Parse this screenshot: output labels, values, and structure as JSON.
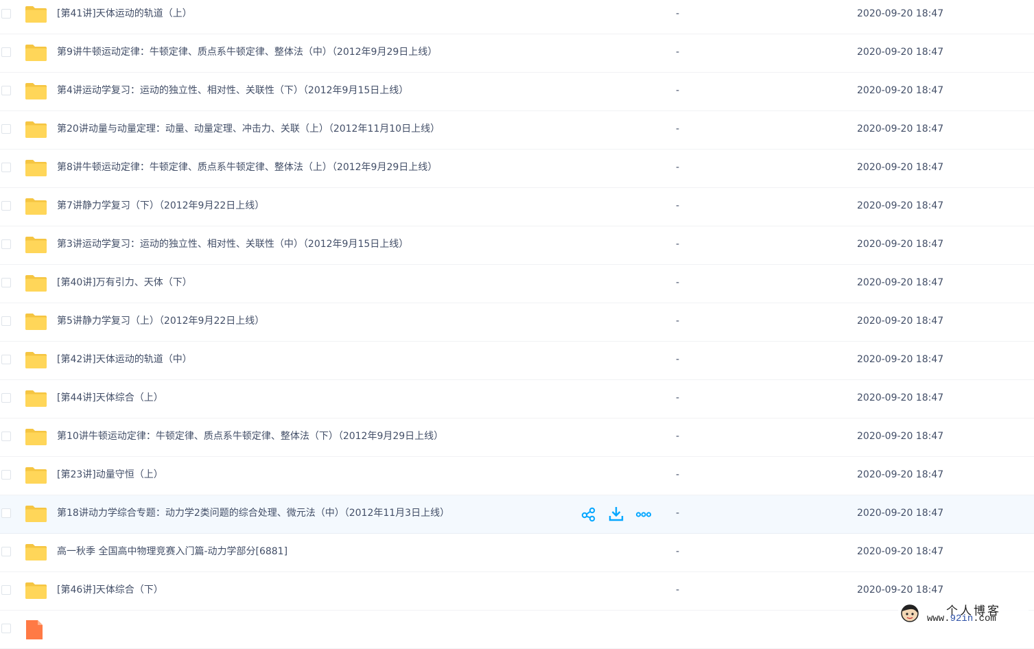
{
  "accent_color": "#06a7ff",
  "folder_color": "#ffd659",
  "rows": [
    {
      "type": "folder",
      "name": "[第41讲]天体运动的轨道（上）",
      "size": "-",
      "date": "2020-09-20 18:47"
    },
    {
      "type": "folder",
      "name": "第9讲牛顿运动定律：牛顿定律、质点系牛顿定律、整体法（中）（2012年9月29日上线）",
      "size": "-",
      "date": "2020-09-20 18:47"
    },
    {
      "type": "folder",
      "name": "第4讲运动学复习：运动的独立性、相对性、关联性（下）（2012年9月15日上线）",
      "size": "-",
      "date": "2020-09-20 18:47"
    },
    {
      "type": "folder",
      "name": "第20讲动量与动量定理：动量、动量定理、冲击力、关联（上）（2012年11月10日上线）",
      "size": "-",
      "date": "2020-09-20 18:47"
    },
    {
      "type": "folder",
      "name": "第8讲牛顿运动定律：牛顿定律、质点系牛顿定律、整体法（上）（2012年9月29日上线）",
      "size": "-",
      "date": "2020-09-20 18:47"
    },
    {
      "type": "folder",
      "name": "第7讲静力学复习（下）（2012年9月22日上线）",
      "size": "-",
      "date": "2020-09-20 18:47"
    },
    {
      "type": "folder",
      "name": "第3讲运动学复习：运动的独立性、相对性、关联性（中）（2012年9月15日上线）",
      "size": "-",
      "date": "2020-09-20 18:47"
    },
    {
      "type": "folder",
      "name": "[第40讲]万有引力、天体（下）",
      "size": "-",
      "date": "2020-09-20 18:47"
    },
    {
      "type": "folder",
      "name": "第5讲静力学复习（上）（2012年9月22日上线）",
      "size": "-",
      "date": "2020-09-20 18:47"
    },
    {
      "type": "folder",
      "name": "[第42讲]天体运动的轨道（中）",
      "size": "-",
      "date": "2020-09-20 18:47"
    },
    {
      "type": "folder",
      "name": "[第44讲]天体综合（上）",
      "size": "-",
      "date": "2020-09-20 18:47"
    },
    {
      "type": "folder",
      "name": "第10讲牛顿运动定律：牛顿定律、质点系牛顿定律、整体法（下）（2012年9月29日上线）",
      "size": "-",
      "date": "2020-09-20 18:47"
    },
    {
      "type": "folder",
      "name": "[第23讲]动量守恒（上）",
      "size": "-",
      "date": "2020-09-20 18:47"
    },
    {
      "type": "folder",
      "name": "第18讲动力学综合专题：动力学2类问题的综合处理、微元法（中）（2012年11月3日上线）",
      "size": "-",
      "date": "2020-09-20 18:47",
      "hover": true
    },
    {
      "type": "folder",
      "name": "高一秋季 全国高中物理竞赛入门篇-动力学部分[6881]",
      "size": "-",
      "date": "2020-09-20 18:47"
    },
    {
      "type": "folder",
      "name": "[第46讲]天体综合（下）",
      "size": "-",
      "date": "2020-09-20 18:47"
    },
    {
      "type": "file",
      "name": "",
      "size": "",
      "date": ""
    }
  ],
  "hover_actions": [
    {
      "name": "share-icon"
    },
    {
      "name": "download-icon"
    },
    {
      "name": "more-icon"
    }
  ],
  "watermark": {
    "title": "个人博客",
    "url_prefix": "www.",
    "url_highlight": "92in",
    "url_suffix": ".com"
  }
}
